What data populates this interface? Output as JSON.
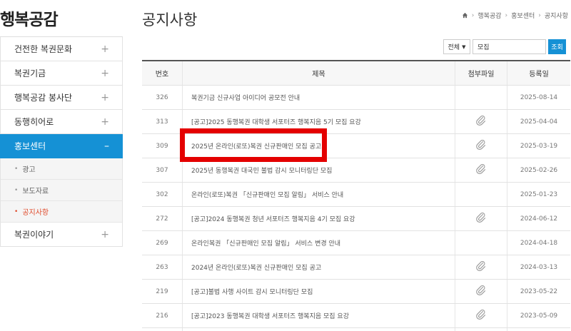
{
  "sidebar": {
    "title": "행복공감",
    "items": [
      {
        "label": "건전한 복권문화",
        "sign": "+"
      },
      {
        "label": "복권기금",
        "sign": "+"
      },
      {
        "label": "행복공감 봉사단",
        "sign": "+"
      },
      {
        "label": "동행히어로",
        "sign": "+"
      },
      {
        "label": "홍보센터",
        "sign": "–"
      },
      {
        "label": "복권이야기",
        "sign": "+"
      }
    ],
    "subitems": [
      {
        "label": "광고"
      },
      {
        "label": "보도자료"
      },
      {
        "label": "공지사항"
      }
    ]
  },
  "header": {
    "title": "공지사항",
    "breadcrumb": [
      "행복공감",
      "홍보센터",
      "공지사항"
    ]
  },
  "search": {
    "select": "전체",
    "value": "모집",
    "button": "조회"
  },
  "board": {
    "columns": [
      "번호",
      "제목",
      "첨부파일",
      "등록일"
    ],
    "rows": [
      {
        "no": "326",
        "title": "복권기금 신규사업 아이디어 공모전 안내",
        "attach": false,
        "date": "2025-08-14"
      },
      {
        "no": "313",
        "title": "[공고]2025 동행복권 대학생 서포터즈 행복지음 5기 모집 요강",
        "attach": true,
        "date": "2025-04-04"
      },
      {
        "no": "309",
        "title": "2025년 온라인(로또)복권 신규판매인 모집 공고",
        "attach": true,
        "date": "2025-03-19"
      },
      {
        "no": "307",
        "title": "2025년 동행복권 대국민 불법 감시 모니터링단 모집",
        "attach": true,
        "date": "2025-02-26"
      },
      {
        "no": "302",
        "title": "온라인(로또)복권 「신규판매인 모집 알림」 서비스 안내",
        "attach": false,
        "date": "2025-01-23"
      },
      {
        "no": "272",
        "title": "[공고]2024 동행복권 청년 서포터즈 행복지음 4기 모집 요강",
        "attach": true,
        "date": "2024-06-12"
      },
      {
        "no": "269",
        "title": "온라인복권 「신규판매인 모집 알림」 서비스 변경 안내",
        "attach": false,
        "date": "2024-04-18"
      },
      {
        "no": "263",
        "title": "2024년 온라인(로또)복권 신규판매인 모집 공고",
        "attach": true,
        "date": "2024-03-13"
      },
      {
        "no": "219",
        "title": "[공고]불법 사행 사이트 감시 모니터링단 모집",
        "attach": true,
        "date": "2023-05-22"
      },
      {
        "no": "216",
        "title": "[공고]2023 동행복권 대학생 서포터즈 행복지음 모집 요강",
        "attach": true,
        "date": "2023-05-09"
      }
    ]
  },
  "colors": {
    "accent": "#1591d5",
    "current_sub": "#e04a2b",
    "highlight": "#e40000"
  },
  "highlighted_row": "309"
}
